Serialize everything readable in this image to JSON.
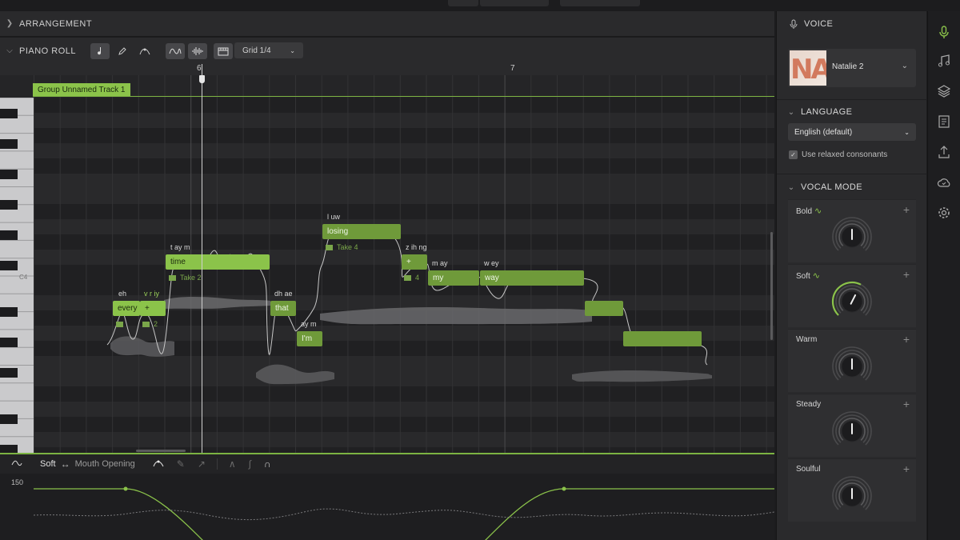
{
  "transport": {
    "pos1": "",
    "pos2": "",
    "time": ""
  },
  "arrangement": {
    "title": "ARRANGEMENT"
  },
  "piano_roll": {
    "title": "PIANO ROLL",
    "grid": "Grid 1/4",
    "ruler": [
      "6",
      "7"
    ],
    "group_label": "Group Unnamed Track 1",
    "key_label": "C4",
    "notes": [
      {
        "lyric": "every",
        "phonemes": "eh",
        "take": ""
      },
      {
        "lyric": "+",
        "phonemes": "v r iy",
        "take": "2"
      },
      {
        "lyric": "time",
        "phonemes": "t ay m",
        "take": "Take 2"
      },
      {
        "lyric": "that",
        "phonemes": "dh ae",
        "take": ""
      },
      {
        "lyric": "I'm",
        "phonemes": "ay m",
        "take": ""
      },
      {
        "lyric": "losing",
        "phonemes": "l uw",
        "take": "Take 4"
      },
      {
        "lyric": "+",
        "phonemes": "z ih ng",
        "take": "4"
      },
      {
        "lyric": "my",
        "phonemes": "m ay",
        "take": ""
      },
      {
        "lyric": "way",
        "phonemes": "w ey",
        "take": ""
      },
      {
        "lyric": "",
        "phonemes": "",
        "take": ""
      },
      {
        "lyric": "",
        "phonemes": "",
        "take": ""
      }
    ]
  },
  "automation": {
    "param": "Soft",
    "target": "Mouth Opening",
    "max_label": "150"
  },
  "voice_panel": {
    "title": "VOICE",
    "voice_name": "Natalie 2",
    "avatar_text": "NA",
    "language_title": "LANGUAGE",
    "language_value": "English (default)",
    "relaxed_label": "Use relaxed consonants",
    "relaxed_checked": true,
    "vocal_mode_title": "VOCAL MODE",
    "modes": [
      {
        "name": "Bold",
        "active": true,
        "level": 0.5
      },
      {
        "name": "Soft",
        "active": true,
        "level": 0.6
      },
      {
        "name": "Warm",
        "active": false,
        "level": 0.5
      },
      {
        "name": "Steady",
        "active": false,
        "level": 0.5
      },
      {
        "name": "Soulful",
        "active": false,
        "level": 0.5
      }
    ]
  },
  "colors": {
    "accent": "#8bc34a",
    "note": "#6f9a3a",
    "bg": "#252527",
    "panel": "#2a2a2c"
  }
}
